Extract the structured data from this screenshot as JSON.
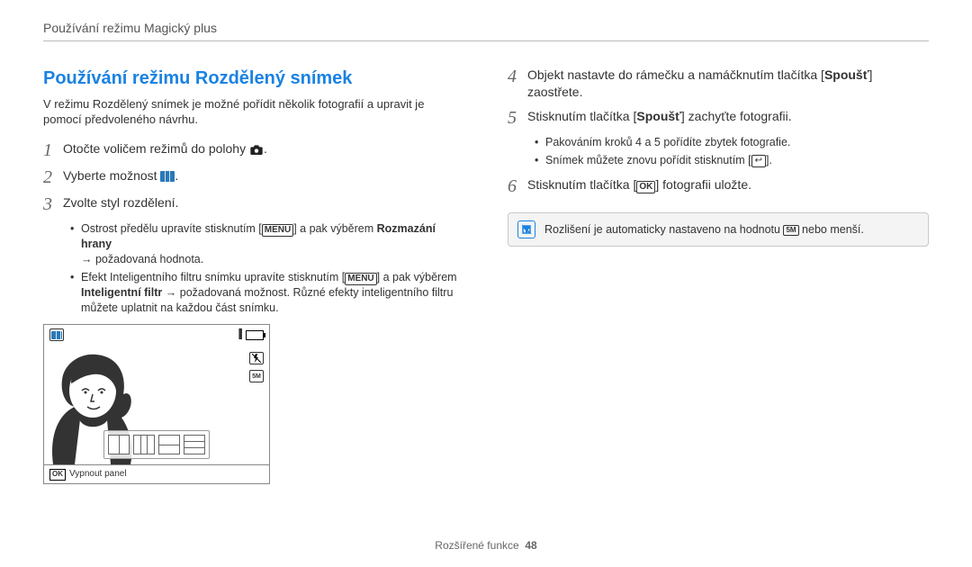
{
  "breadcrumb": "Používání režimu Magický plus",
  "section_title": "Používání režimu Rozdělený snímek",
  "intro": "V režimu Rozdělený snímek je možné pořídit několik fotografií a upravit je pomocí předvoleného návrhu.",
  "left": {
    "step1": {
      "num": "1",
      "text_a": "Otočte voličem režimů do polohy ",
      "text_b": "."
    },
    "step2": {
      "num": "2",
      "text_a": "Vyberte možnost ",
      "text_b": "."
    },
    "step3": {
      "num": "3",
      "text": "Zvolte styl rozdělení."
    },
    "bullets": {
      "b1_a": "Ostrost předělu upravíte stisknutím [",
      "b1_menu": "MENU",
      "b1_b": "] a pak výběrem ",
      "b1_bold": "Rozmazání hrany",
      "b1_c": " ",
      "b1_arrow": "→",
      "b1_d": " požadovaná hodnota.",
      "b2_a": "Efekt Inteligentního filtru snímku upravíte stisknutím [",
      "b2_menu": "MENU",
      "b2_b": "] a pak výběrem ",
      "b2_bold": "Inteligentní filtr",
      "b2_c": " ",
      "b2_arrow": "→",
      "b2_d": " požadovaná možnost. Různé efekty inteligentního filtru můžete uplatnit na každou část snímku."
    },
    "device": {
      "ok_label": "OK",
      "footer_text": "Vypnout panel"
    }
  },
  "right": {
    "step4": {
      "num": "4",
      "text_a": "Objekt nastavte do rámečku a namáčknutím tlačítka [",
      "bold": "Spoušť",
      "text_b": "] zaostřete."
    },
    "step5": {
      "num": "5",
      "text_a": "Stisknutím tlačítka [",
      "bold": "Spoušť",
      "text_b": "] zachyťte fotografii."
    },
    "bullets5": {
      "b1": "Pakováním kroků 4 a 5 pořídíte zbytek fotografie.",
      "b2_a": "Snímek můžete znovu pořídit stisknutím [",
      "b2_b": "]."
    },
    "step6": {
      "num": "6",
      "text_a": "Stisknutím tlačítka [",
      "ok": "OK",
      "text_b": "] fotografii uložte."
    },
    "note": {
      "text_a": "Rozlišení je automaticky nastaveno na hodnotu ",
      "res": "5M",
      "text_b": " nebo menší."
    }
  },
  "footer": {
    "label": "Rozšířené funkce",
    "page": "48"
  }
}
